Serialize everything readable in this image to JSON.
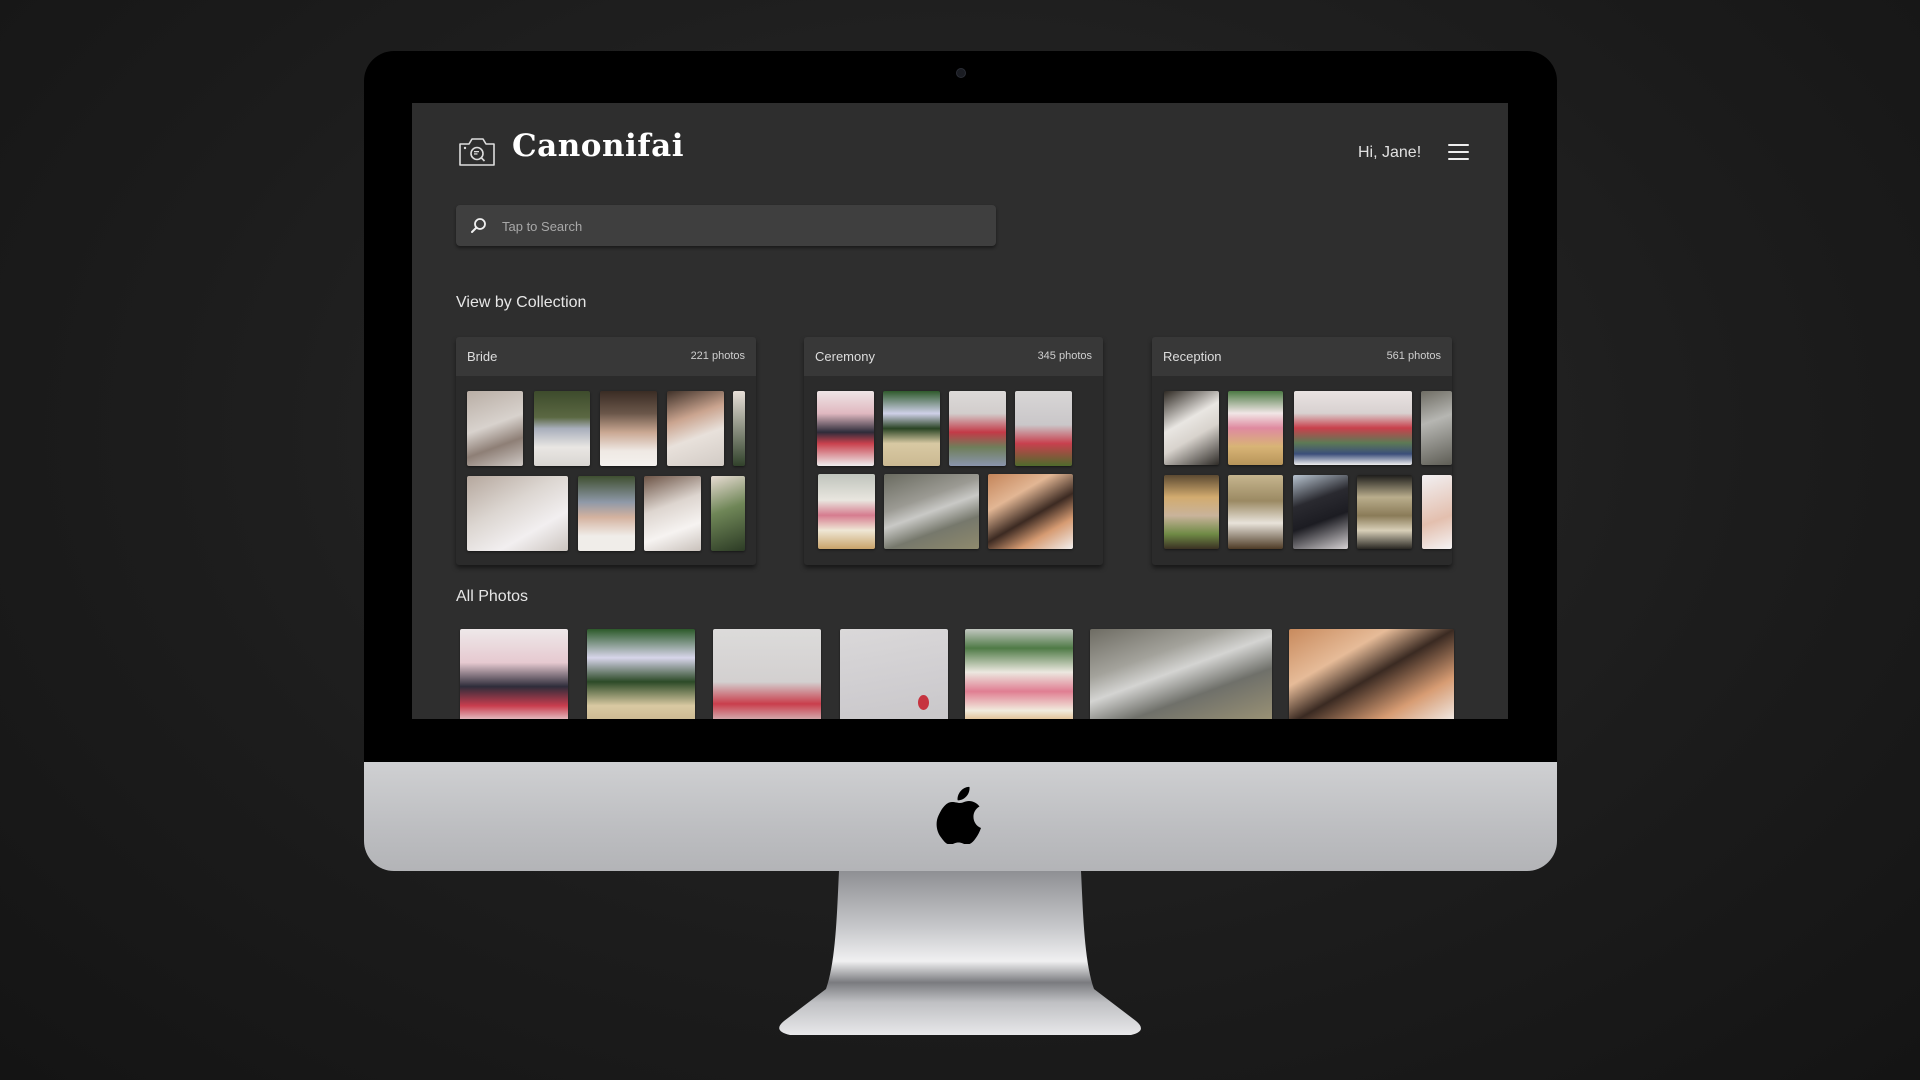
{
  "app": {
    "name": "Canonifai",
    "logo_icon": "camera-search-icon",
    "greeting": "Hi, Jane!",
    "menu_icon": "hamburger-menu-icon"
  },
  "search": {
    "placeholder": "Tap to Search",
    "value": "",
    "icon": "search-icon"
  },
  "collections": {
    "title": "View by Collection",
    "items": [
      {
        "name": "Bride",
        "count": "221 photos",
        "photos": [
          "bride-dress-detail",
          "bride-veil-smile",
          "bride-tiara-smile",
          "bride-lace-back",
          "bride-partial",
          "bride-hands-dress",
          "bride-veil-portrait",
          "bride-lace-side",
          "bride-hand-green"
        ]
      },
      {
        "name": "Ceremony",
        "count": "345 photos",
        "photos": [
          "couple-balloons",
          "wedding-arch-aisle",
          "guests-red-balloons",
          "red-balloons-sky",
          "flower-bouquet",
          "wedding-rings",
          "holding-hands"
        ]
      },
      {
        "name": "Reception",
        "count": "561 photos",
        "photos": [
          "couple-seated",
          "table-flowers",
          "guests-balloons-wide",
          "rings-partial",
          "toast-glasses",
          "banquet-hall",
          "couple-silhouette",
          "wedding-cake",
          "hands-partial"
        ]
      }
    ]
  },
  "all_photos": {
    "title": "All Photos",
    "photos": [
      "couple-balloons",
      "wedding-arch-aisle",
      "red-balloons",
      "single-balloon-sky",
      "flower-bouquet",
      "wedding-rings",
      "holding-hands"
    ]
  },
  "device": {
    "type": "desktop-monitor",
    "brand_icon": "apple-logo-icon"
  },
  "palette": {
    "screen_bg": "#2e2e2e",
    "card_bg": "#2b2b2b",
    "card_header": "#383838",
    "search_bg": "#3f3f3f",
    "text": "#e6e6e6"
  }
}
